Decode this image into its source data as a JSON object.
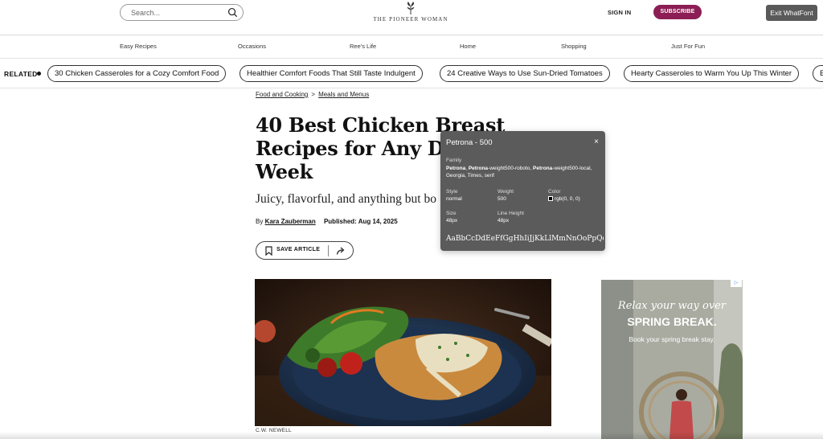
{
  "header": {
    "search_placeholder": "Search...",
    "logo_text": "THE PIONEER WOMAN",
    "sign_in": "SIGN IN",
    "subscribe": "SUBSCRIBE",
    "subscribe_color": "#8c1e55",
    "exit_whatfont": "Exit WhatFont"
  },
  "nav": {
    "items": [
      "Easy Recipes",
      "Occasions",
      "Ree's Life",
      "Home",
      "Shopping",
      "Just For Fun"
    ]
  },
  "related": {
    "label": "RELATED",
    "chips": [
      "30 Chicken Casseroles for a Cozy Comfort Food",
      "Healthier Comfort Foods That Still Taste Indulgent",
      "24 Creative Ways to Use Sun-Dried Tomatoes",
      "Hearty Casseroles to Warm You Up This Winter",
      "B"
    ]
  },
  "article": {
    "breadcrumb": [
      "Food and Cooking",
      "Meals and Menus"
    ],
    "breadcrumb_sep": ">",
    "title_lines": [
      "40 Best Chicken Breast",
      "Recipes for Any Da",
      "Week"
    ],
    "dek": "Juicy, flavorful, and anything but bo",
    "byline_prefix": "By",
    "author": "Kara Zauberman",
    "published": "Published: Aug 14, 2025",
    "save_label": "SAVE ARTICLE",
    "image_credit": "C.W. NEWELL"
  },
  "ad": {
    "line1": "Relax your way over",
    "line2": "SPRING BREAK.",
    "line3": "Book your spring break stay.",
    "choices": "▷"
  },
  "whatfont": {
    "heading": "Petrona - 500",
    "close": "×",
    "family_label": "Family",
    "family_parts": [
      "Petrona",
      ", ",
      "Petrona",
      "-weight500-roboto, ",
      "Petrona",
      "-weight500-local, Georgia, Times, serif"
    ],
    "style_label": "Style",
    "style_value": "normal",
    "weight_label": "Weight",
    "weight_value": "500",
    "color_label": "Color",
    "color_value": "rgb(0, 0, 0)",
    "size_label": "Size",
    "size_value": "48px",
    "line_height_label": "Line Height",
    "line_height_value": "48px",
    "sample": "AaBbCcDdEeFfGgHhIiJjKkLlMmNnOoPpQqRrSs"
  }
}
